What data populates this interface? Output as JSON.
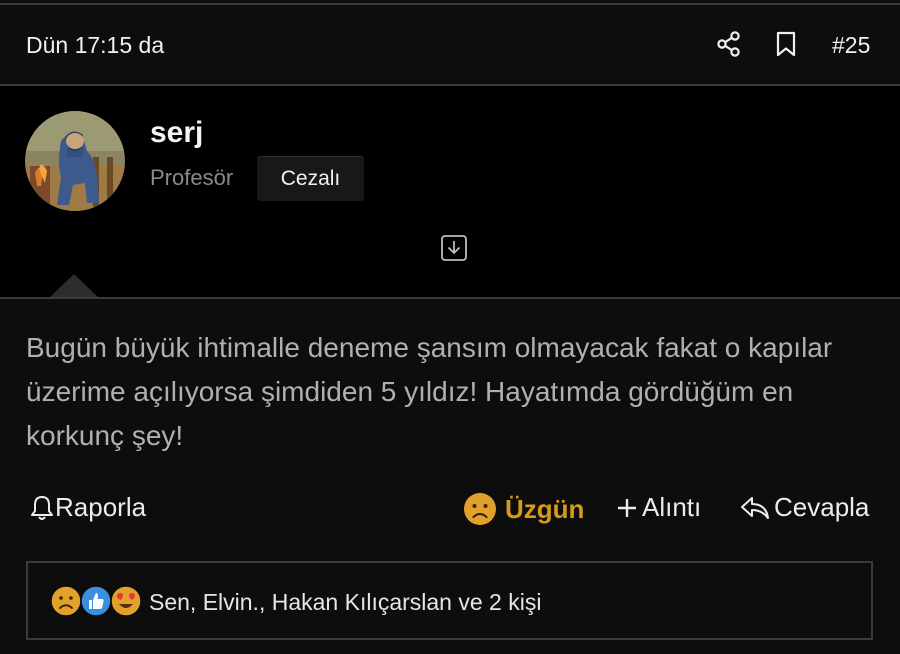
{
  "header": {
    "date": "Dün 17:15 da",
    "share_icon": "share-icon",
    "bookmark_icon": "bookmark-icon",
    "post_number": "#25"
  },
  "user": {
    "name": "serj",
    "title": "Profesör",
    "badge": "Cezalı",
    "avatar": "avatar-painting",
    "expand_icon": "expand-down-icon"
  },
  "post": {
    "body": "Bugün büyük ihtimalle deneme şansım olmayacak fakat o kapılar üzerime açılıyorsa şimdiden 5 yıldız! Hayatımda gördüğüm en korkunç şey!"
  },
  "actions": {
    "report": "Raporla",
    "reaction": "Üzgün",
    "quote": "Alıntı",
    "reply": "Cevapla"
  },
  "reactions": {
    "icons": [
      "sad-face-icon",
      "thumbs-up-icon",
      "heart-eyes-icon"
    ],
    "summary": "Sen, Elvin., Hakan Kılıçarslan ve 2 kişi"
  },
  "colors": {
    "background": "#000000",
    "panel": "#0d0d0d",
    "reaction_accent": "#d89a18",
    "divider": "#3a3a3a",
    "muted_text": "#8a8a8a"
  }
}
